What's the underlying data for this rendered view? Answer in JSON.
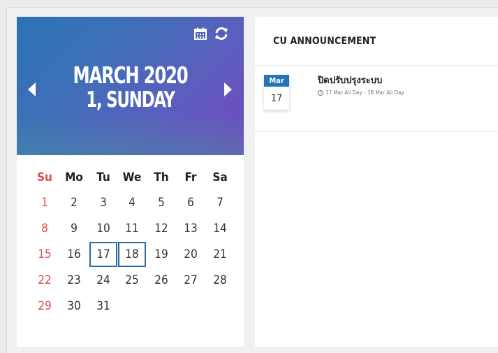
{
  "calendar": {
    "month_year": "MARCH 2020",
    "day_label": "1, SUNDAY",
    "weekdays": [
      "Su",
      "Mo",
      "Tu",
      "We",
      "Th",
      "Fr",
      "Sa"
    ],
    "weeks": [
      [
        "1",
        "2",
        "3",
        "4",
        "5",
        "6",
        "7"
      ],
      [
        "8",
        "9",
        "10",
        "11",
        "12",
        "13",
        "14"
      ],
      [
        "15",
        "16",
        "17",
        "18",
        "19",
        "20",
        "21"
      ],
      [
        "22",
        "23",
        "24",
        "25",
        "26",
        "27",
        "28"
      ],
      [
        "29",
        "30",
        "31",
        "",
        "",
        "",
        ""
      ]
    ],
    "highlighted_days": [
      "17",
      "18"
    ],
    "colors": {
      "weekend": "#e0484c",
      "highlight": "#2b6ca3"
    },
    "icons": [
      "calendar-icon",
      "refresh-icon",
      "prev-month-icon",
      "next-month-icon"
    ]
  },
  "announcements": {
    "title": "CU ANNOUNCEMENT",
    "items": [
      {
        "month": "Mar",
        "day": "17",
        "title": "ปิดปรับปรุงระบบ",
        "time": "17 Mar All Day - 18 Mar All Day"
      }
    ]
  }
}
